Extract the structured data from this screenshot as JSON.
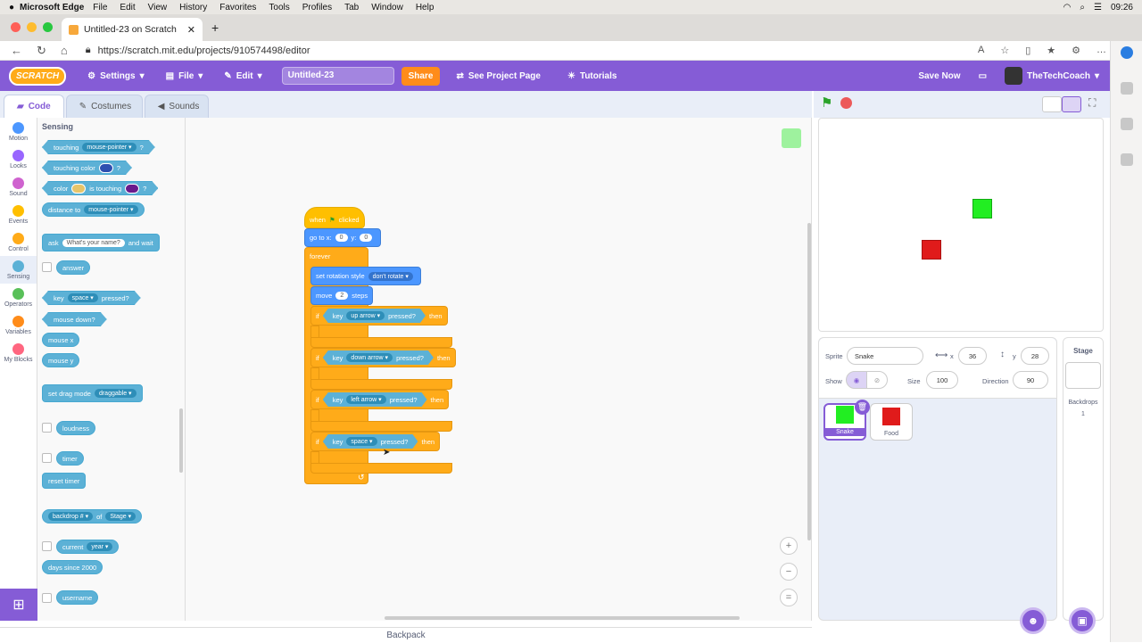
{
  "mac": {
    "app": "Microsoft Edge",
    "menus": [
      "File",
      "Edit",
      "View",
      "History",
      "Favorites",
      "Tools",
      "Profiles",
      "Tab",
      "Window",
      "Help"
    ],
    "time": "09:26"
  },
  "browser": {
    "tab_title": "Untitled-23 on Scratch",
    "url": "https://scratch.mit.edu/projects/910574498/editor"
  },
  "menubar": {
    "logo": "SCRATCH",
    "settings": "Settings",
    "file": "File",
    "edit": "Edit",
    "project_title": "Untitled-23",
    "share": "Share",
    "see_project": "See Project Page",
    "tutorials": "Tutorials",
    "save_now": "Save Now",
    "user": "TheTechCoach"
  },
  "tabs": {
    "code": "Code",
    "costumes": "Costumes",
    "sounds": "Sounds"
  },
  "categories": [
    {
      "label": "Motion",
      "color": "#4c97ff"
    },
    {
      "label": "Looks",
      "color": "#9966ff"
    },
    {
      "label": "Sound",
      "color": "#cf63cf"
    },
    {
      "label": "Events",
      "color": "#ffbf00"
    },
    {
      "label": "Control",
      "color": "#ffab19"
    },
    {
      "label": "Sensing",
      "color": "#5cb1d6"
    },
    {
      "label": "Operators",
      "color": "#59c059"
    },
    {
      "label": "Variables",
      "color": "#ff8c1a"
    },
    {
      "label": "My Blocks",
      "color": "#ff6680"
    }
  ],
  "palette": {
    "title": "Sensing",
    "touching": "touching",
    "mouse_pointer": "mouse-pointer",
    "q": "?",
    "touching_color": "touching color",
    "color": "color",
    "is_touching": "is touching",
    "distance_to": "distance to",
    "ask": "ask",
    "ask_default": "What's your name?",
    "and_wait": "and wait",
    "answer": "answer",
    "key": "key",
    "space": "space",
    "pressed": "pressed?",
    "mouse_down": "mouse down?",
    "mouse_x": "mouse x",
    "mouse_y": "mouse y",
    "set_drag_mode": "set drag mode",
    "draggable": "draggable",
    "loudness": "loudness",
    "timer": "timer",
    "reset_timer": "reset timer",
    "backdrop": "backdrop #",
    "of": "of",
    "stage": "Stage",
    "current": "current",
    "year": "year",
    "days_since": "days since 2000",
    "username": "username"
  },
  "script": {
    "when": "when",
    "clicked": "clicked",
    "goto": "go to x:",
    "x_val": "0",
    "y_lbl": "y:",
    "y_val": "0",
    "forever": "forever",
    "rotation": "set rotation style",
    "dont_rotate": "don't rotate",
    "move": "move",
    "steps_val": "2",
    "steps": "steps",
    "if": "if",
    "then": "then",
    "key": "key",
    "pressed": "pressed?",
    "up": "up arrow",
    "down": "down arrow",
    "left": "left arrow",
    "space": "space"
  },
  "zoom": {
    "in": "+",
    "out": "−",
    "reset": "="
  },
  "backpack": "Backpack",
  "sprite_info": {
    "sprite_lbl": "Sprite",
    "sprite_name": "Snake",
    "x_lbl": "x",
    "x": "36",
    "y_lbl": "y",
    "y": "28",
    "show_lbl": "Show",
    "size_lbl": "Size",
    "size": "100",
    "dir_lbl": "Direction",
    "direction": "90"
  },
  "sprites": [
    {
      "name": "Snake",
      "color": "#22ee22"
    },
    {
      "name": "Food",
      "color": "#e01b1b"
    }
  ],
  "stage_pane": {
    "title": "Stage",
    "backdrops_lbl": "Backdrops",
    "backdrops": "1"
  },
  "colors": {
    "accent": "#855cd6",
    "snake": "#22ee22",
    "food": "#e01b1b"
  }
}
